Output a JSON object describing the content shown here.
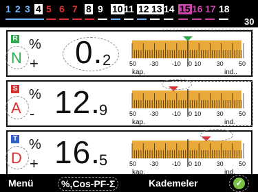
{
  "steps": {
    "items": [
      {
        "label": "1",
        "style": "plain",
        "color": "#6fb7ff",
        "bar": "#6fb7ff"
      },
      {
        "label": "2",
        "style": "plain",
        "color": "#6fb7ff",
        "bar": "#6fb7ff"
      },
      {
        "label": "3",
        "style": "plain",
        "color": "#6fb7ff",
        "bar": "#6fb7ff"
      },
      {
        "label": "4",
        "style": "boxed",
        "color": "#000000",
        "bar": "#6fb7ff"
      },
      {
        "label": "5",
        "style": "plain",
        "color": "#e03030",
        "bar": "#e03030"
      },
      {
        "label": "6",
        "style": "plain",
        "color": "#e03030",
        "bar": "#e03030"
      },
      {
        "label": "7",
        "style": "plain",
        "color": "#e03030",
        "bar": "#e03030"
      },
      {
        "label": "8",
        "style": "boxed",
        "color": "#000000",
        "bar": "#e03030"
      },
      {
        "label": "9",
        "style": "plain",
        "color": "#ffffff",
        "bar": "#ffffff"
      },
      {
        "label": "10",
        "style": "boxed",
        "color": "#000000",
        "bar": "#6fb7ff"
      },
      {
        "label": "11",
        "style": "plain",
        "color": "#ffffff",
        "bar": "#ffffff"
      },
      {
        "label": "12",
        "style": "boxed",
        "color": "#000000",
        "bar": "#6fb7ff"
      },
      {
        "label": "13",
        "style": "boxed",
        "color": "#000000",
        "bar": "#ffffff"
      },
      {
        "label": "14",
        "style": "plain",
        "color": "#ffffff",
        "bar": "#ffffff"
      },
      {
        "label": "15",
        "style": "boxed-pink",
        "color": "#000000",
        "bar": "#cc44aa"
      },
      {
        "label": "16",
        "style": "plain",
        "color": "#cc44aa",
        "bar": "#cc44aa"
      },
      {
        "label": "17",
        "style": "plain",
        "color": "#cc44aa",
        "bar": "#cc44aa"
      },
      {
        "label": "18",
        "style": "plain",
        "color": "#ffffff",
        "bar": "#ffffff"
      }
    ],
    "total": "30"
  },
  "panels": [
    {
      "tag": "R",
      "tag_color": "#2fa84f",
      "phase": "N",
      "phase_color": "#2fa84f",
      "unit": "%",
      "sign": "+",
      "value_int": "0.",
      "value_dec": "2",
      "gauge": {
        "marker_color": "#2fa84f",
        "marker_value": 0,
        "scale": [
          "-50",
          "-30",
          "-10",
          "0",
          "10",
          "30",
          "50"
        ],
        "left_label": "kap.",
        "right_label": "ind..",
        "fill_to": 0.4
      }
    },
    {
      "tag": "S",
      "tag_color": "#d63030",
      "phase": "A",
      "phase_color": "#d63030",
      "unit": "%",
      "sign": "-",
      "value_int": "12.",
      "value_dec": "9",
      "gauge": {
        "marker_color": "#d63030",
        "marker_value": -12.9,
        "scale": [
          "-50",
          "-30",
          "-10",
          "0",
          "10",
          "30",
          "50"
        ],
        "left_label": "kap.",
        "right_label": "ind.",
        "fill_to": -12.9
      }
    },
    {
      "tag": "T",
      "tag_color": "#3060c8",
      "phase": "D",
      "phase_color": "#d63030",
      "unit": "%",
      "sign": "+",
      "value_int": "16.",
      "value_dec": "5",
      "gauge": {
        "marker_color": "#d63030",
        "marker_value": 16.5,
        "scale": [
          "-50",
          "-30",
          "-10",
          "0",
          "10",
          "30",
          "50"
        ],
        "left_label": "kap.",
        "right_label": "ind.",
        "fill_to": 16.5
      }
    }
  ],
  "softkeys": {
    "menu": "Menü",
    "mode": "%,Cos-PF-Σ",
    "steps": "Kademeler",
    "ok_icon": "check-icon"
  }
}
